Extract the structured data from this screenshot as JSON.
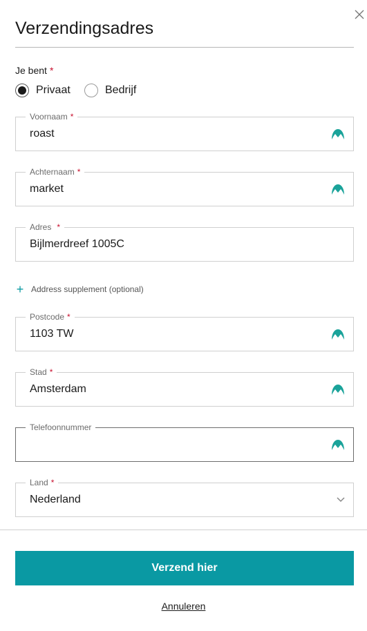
{
  "dialog": {
    "title": "Verzendingsadres",
    "close_icon": "close-icon"
  },
  "customer_type": {
    "label": "Je bent",
    "required_mark": "*",
    "options": [
      {
        "label": "Privaat",
        "selected": true
      },
      {
        "label": "Bedrijf",
        "selected": false
      }
    ]
  },
  "fields": {
    "first_name": {
      "label": "Voornaam",
      "required_mark": "*",
      "value": "roast",
      "icon": "autofill-icon"
    },
    "last_name": {
      "label": "Achternaam",
      "required_mark": "*",
      "value": "market",
      "icon": "autofill-icon"
    },
    "address": {
      "label": "Adres",
      "required_mark": "*",
      "value": "Bijlmerdreef 1005C"
    },
    "postcode": {
      "label": "Postcode",
      "required_mark": "*",
      "value": "1103 TW",
      "icon": "autofill-icon"
    },
    "city": {
      "label": "Stad",
      "required_mark": "*",
      "value": "Amsterdam",
      "icon": "autofill-icon"
    },
    "phone": {
      "label": "Telefoonnummer",
      "value": "",
      "icon": "autofill-icon"
    },
    "country": {
      "label": "Land",
      "required_mark": "*",
      "value": "Nederland",
      "icon": "chevron-down-icon"
    }
  },
  "address_supplement": {
    "icon": "plus-icon",
    "label": "Address supplement (optional)"
  },
  "actions": {
    "submit_label": "Verzend hier",
    "cancel_label": "Annuleren"
  },
  "colors": {
    "accent": "#0a99a3",
    "required": "#c8102e",
    "text": "#1a1a1a",
    "border": "#cfcfcf"
  }
}
